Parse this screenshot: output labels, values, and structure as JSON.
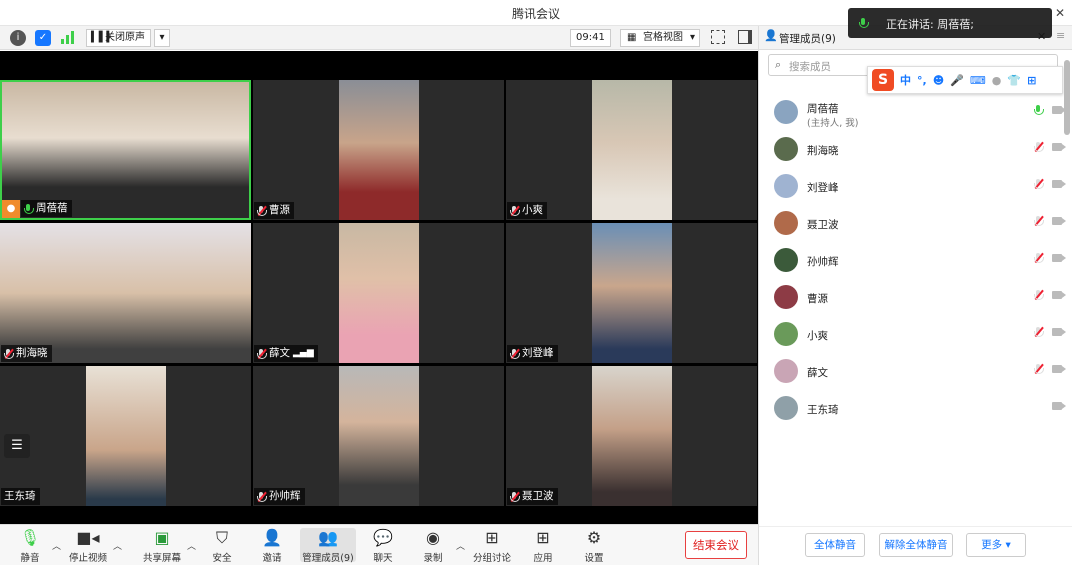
{
  "window": {
    "title": "腾讯会议"
  },
  "toolbar": {
    "mute_original": "关闭原声",
    "time": "09:41",
    "view": "宫格视图"
  },
  "tiles": [
    {
      "name": "周蓓蓓",
      "mic": "active"
    },
    {
      "name": "曹源",
      "mic": "muted"
    },
    {
      "name": "小爽",
      "mic": "muted"
    },
    {
      "name": "荆海晓",
      "mic": "muted"
    },
    {
      "name": "薛文",
      "mic": "muted"
    },
    {
      "name": "刘登峰",
      "mic": "muted"
    },
    {
      "name": "王东琦",
      "mic": "none"
    },
    {
      "name": "孙帅辉",
      "mic": "muted"
    },
    {
      "name": "聂卫波",
      "mic": "muted"
    }
  ],
  "bottombar": {
    "mute": "静音",
    "stop_video": "停止视频",
    "share": "共享屏幕",
    "security": "安全",
    "invite": "邀请",
    "manage": "管理成员(9)",
    "chat": "聊天",
    "record": "录制",
    "breakout": "分组讨论",
    "apps": "应用",
    "settings": "设置",
    "end": "结束会议"
  },
  "panel": {
    "title": "管理成员(9)",
    "search_placeholder": "搜索成员",
    "ime_labels": [
      "中",
      "°,"
    ],
    "members": [
      {
        "name": "周蓓蓓",
        "sub": "(主持人, 我)",
        "mic": "active",
        "avatar": "#8aa4c0"
      },
      {
        "name": "荆海晓",
        "sub": "",
        "mic": "muted",
        "avatar": "#5a6b4d"
      },
      {
        "name": "刘登峰",
        "sub": "",
        "mic": "muted",
        "avatar": "#9fb3d1"
      },
      {
        "name": "聂卫波",
        "sub": "",
        "mic": "muted",
        "avatar": "#b06a4a"
      },
      {
        "name": "孙帅辉",
        "sub": "",
        "mic": "muted",
        "avatar": "#3b5a3a"
      },
      {
        "name": "曹源",
        "sub": "",
        "mic": "muted",
        "avatar": "#8d3b45"
      },
      {
        "name": "小爽",
        "sub": "",
        "mic": "muted",
        "avatar": "#6a9a5a"
      },
      {
        "name": "薛文",
        "sub": "",
        "mic": "muted",
        "avatar": "#c9a5b5"
      },
      {
        "name": "王东琦",
        "sub": "",
        "mic": "none",
        "avatar": "#8fa0a8"
      }
    ],
    "mute_all": "全体静音",
    "unmute_all": "解除全体静音",
    "more": "更多 ▾"
  },
  "toast": {
    "text": "正在讲话: 周蓓蓓;"
  },
  "colors": {
    "accent": "#1677ff",
    "end_red": "#e02020",
    "speaking_green": "#3ecf4a"
  }
}
